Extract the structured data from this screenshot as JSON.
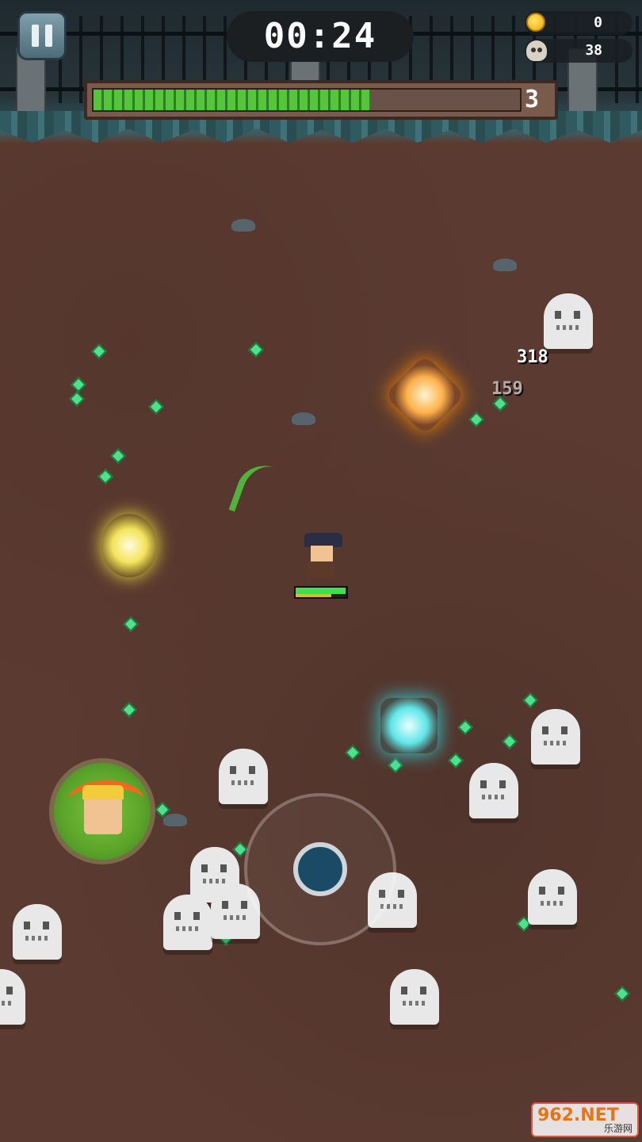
{
  "hud": {
    "timer": "00:24",
    "coins": "0",
    "kills": "38",
    "level": "3",
    "xp_progress": 0.65
  },
  "player": {
    "hp_fraction": 0.98,
    "mp_fraction": 0.7
  },
  "damage_numbers": {
    "first": "318",
    "second": "159"
  },
  "watermark": {
    "main": "962.NET",
    "sub": "乐游网"
  },
  "icons": {
    "pause": "pause-icon",
    "coin": "coin-icon",
    "skull": "skull-icon",
    "skill": "dash-skill-icon"
  },
  "colors": {
    "ground": "#5b3b31",
    "xp_green": "#55c63c",
    "hp_green": "#3fe04a",
    "gem_green": "#4fe08a"
  }
}
